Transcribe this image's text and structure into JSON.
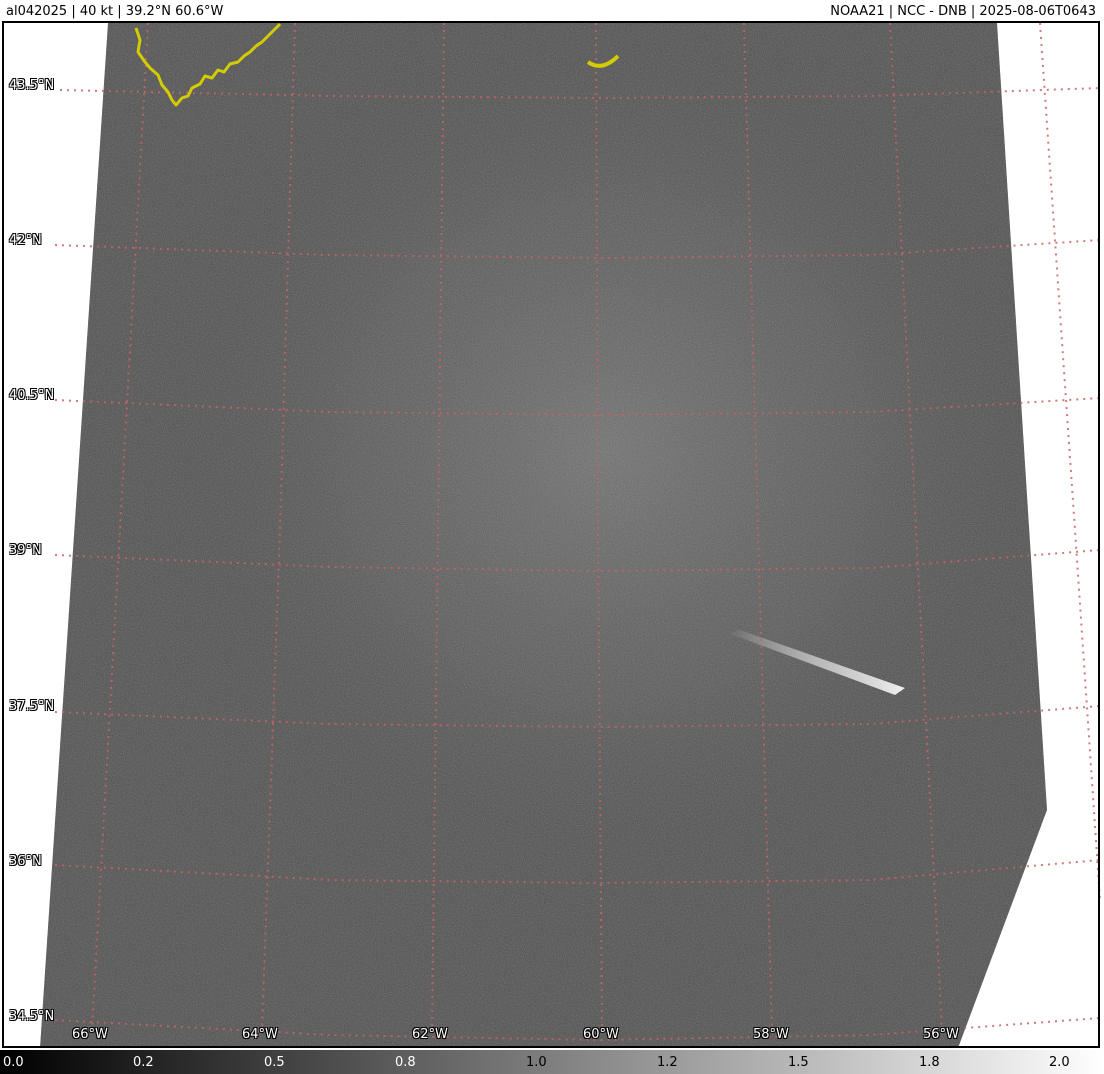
{
  "header": {
    "left_text": "al042025     | 40 kt | 39.2°N 60.6°W",
    "right_text": "NOAA21 | NCC - DNB | 2025-08-06T0643"
  },
  "map": {
    "lat_labels": [
      "43.5°N",
      "42°N",
      "40.5°N",
      "39°N",
      "37.5°N",
      "36°N",
      "34.5°N"
    ],
    "lon_labels": [
      "66°W",
      "64°W",
      "62°W",
      "60°W",
      "58°W",
      "56°W"
    ],
    "coastline_color": "#d4cc00",
    "grid_color": "#c86464"
  },
  "colorbar": {
    "tick_labels": [
      "0.0",
      "0.2",
      "0.5",
      "0.8",
      "1.0",
      "1.2",
      "1.5",
      "1.8",
      "2.0"
    ],
    "gradient_start": "#000000",
    "gradient_end": "#ffffff"
  }
}
